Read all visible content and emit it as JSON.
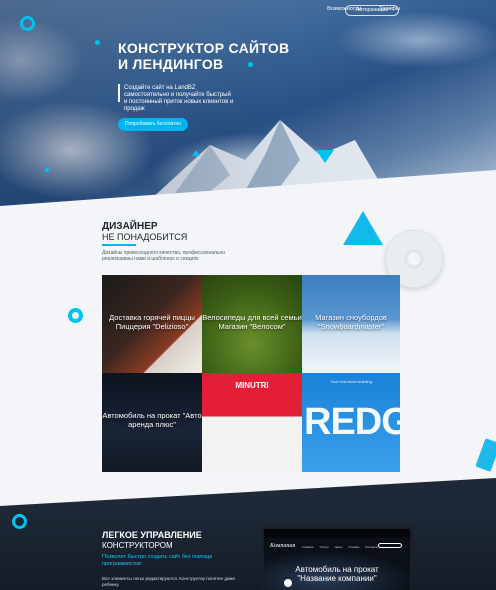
{
  "nav": {
    "items": [
      "Возможности",
      "Тарифы"
    ],
    "auth": "Авторизация"
  },
  "hero": {
    "title_line1": "КОНСТРУКТОР САЙТОВ",
    "title_line2": "И ЛЕНДИНГОВ",
    "text": "Создайте сайт на LandBZ самостоятельно и получайте быстрый и постоянный приток новых клиентов и продаж",
    "cta": "Попробовать бесплатно"
  },
  "designer": {
    "title": "ДИЗАЙНЕР",
    "subtitle": "НЕ ПОНАДОБИТСЯ",
    "text": "Дизайны превосходного качества, профессионально реализованы нами в шаблонах и секциях"
  },
  "templates": [
    {
      "title": "Доставка горячей пиццы Пиццерия \"Delizioso\""
    },
    {
      "title": "Велосипеды для всей семьи Магазин \"Велосом\""
    },
    {
      "title": "Магазин сноубордов \"Snowboardmaster\""
    },
    {
      "title": "Автомобиль на прокат \"Авто аренда плюс\""
    },
    {
      "brand": "MINUTRI"
    },
    {
      "brand": "REDG",
      "caption": "Your best team building"
    }
  ],
  "management": {
    "title": "ЛЕГКОЕ УПРАВЛЕНИЕ",
    "subtitle": "КОНСТРУКТОРОМ",
    "accent": "Позволит быстро создать сайт без помощи программистов",
    "text": "Все элементы легко редактируются. Конструктор понятен даже ребенку"
  },
  "preview": {
    "logo": "Компания",
    "menu": [
      "Главная",
      "Услуги",
      "Цены",
      "Отзывы",
      "Контакты"
    ],
    "headline_line1": "Автомобиль на прокат",
    "headline_line2": "\"Название компании\""
  },
  "colors": {
    "accent": "#00b5ee",
    "dark": "#1e2836"
  }
}
